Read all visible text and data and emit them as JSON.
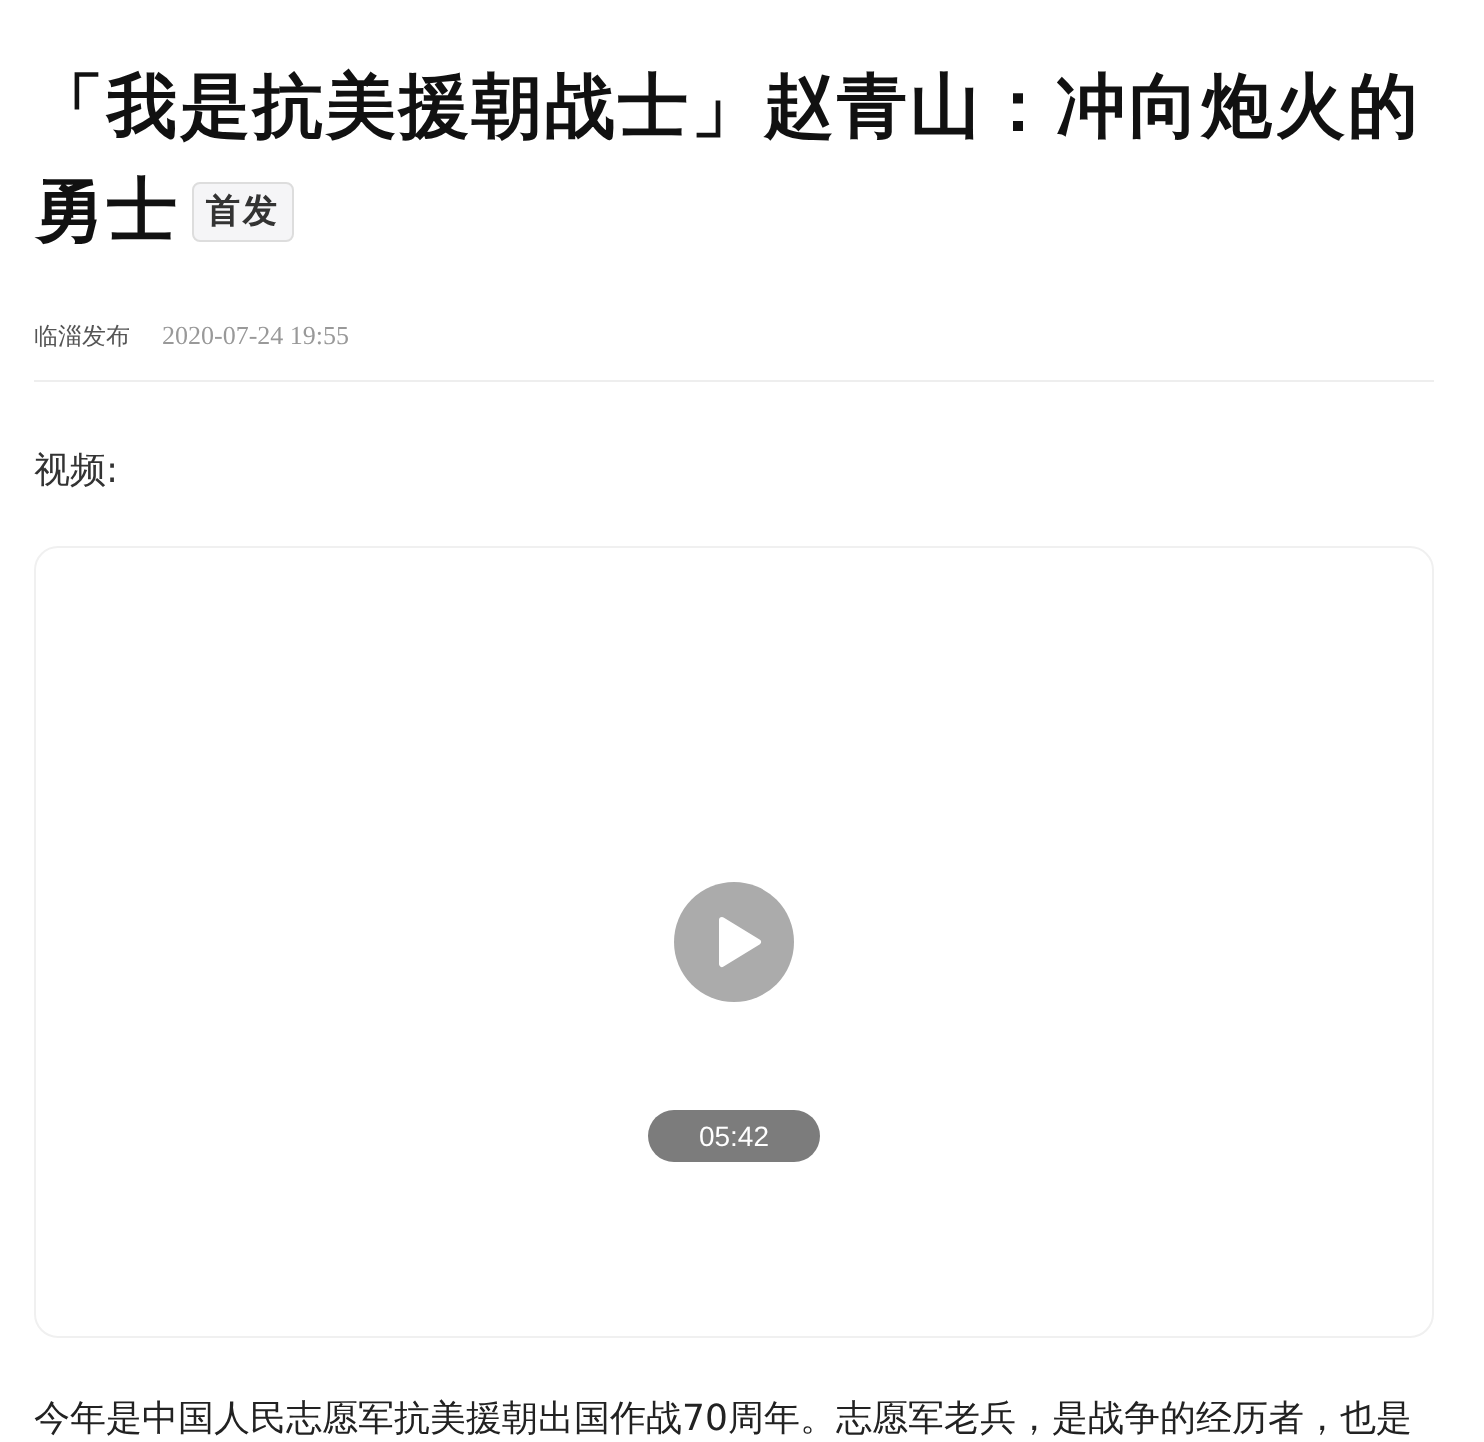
{
  "article": {
    "title_lines": [
      "「我是抗美援朝战士」赵青山：冲向炮火的",
      "勇士"
    ],
    "badge": "首发",
    "source": "临淄发布",
    "date": "2020-07-24 19:55",
    "video_label": "视频:",
    "video": {
      "duration": "05:42"
    },
    "paragraph": "今年是中国人民志愿军抗美援朝出国作战70周年。志愿军老兵，是战争的经历者，也是"
  }
}
